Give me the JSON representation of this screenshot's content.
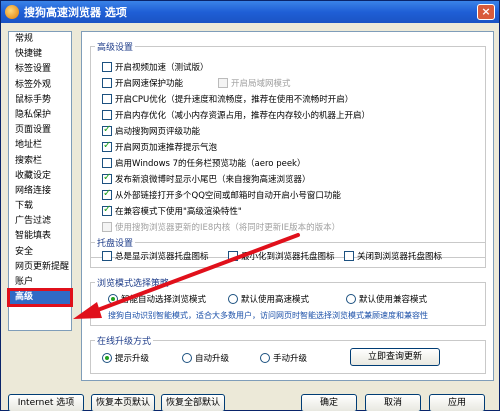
{
  "window": {
    "title": "搜狗高速浏览器 选项",
    "close_label": "×"
  },
  "sidebar": {
    "items": [
      "常规",
      "快捷键",
      "标签设置",
      "标签外观",
      "鼠标手势",
      "隐私保护",
      "页面设置",
      "地址栏",
      "搜索栏",
      "收藏设定",
      "网络连接",
      "下载",
      "广告过滤",
      "智能填表",
      "安全",
      "网页更新提醒",
      "账户",
      "高级"
    ],
    "selected": "高级"
  },
  "advanced": {
    "legend": "高级设置",
    "items": [
      {
        "label": "开启视频加速（测试版）",
        "checked": false,
        "disabled": false
      },
      {
        "label": "开启网速保护功能",
        "checked": false,
        "disabled": false
      },
      {
        "label": "开启局域网模式",
        "checked": false,
        "disabled": true
      },
      {
        "label": "开启CPU优化（提升速度和流畅度，推荐在使用不流畅时开启）",
        "checked": false,
        "disabled": false
      },
      {
        "label": "开启内存优化（减小内存资源占用，推荐在内存较小的机器上开启）",
        "checked": false,
        "disabled": false
      },
      {
        "label": "启动搜狗网页评级功能",
        "checked": true,
        "disabled": false
      },
      {
        "label": "开启网页加速推荐提示气泡",
        "checked": true,
        "disabled": false
      },
      {
        "label": "启用Windows 7的任务栏预览功能（aero peek）",
        "checked": false,
        "disabled": false
      },
      {
        "label": "发布新浪微博时显示小尾巴（来自搜狗高速浏览器）",
        "checked": true,
        "disabled": false
      },
      {
        "label": "从外部链接打开多个QQ空间或邮箱时自动开启小号窗口功能",
        "checked": true,
        "disabled": false
      },
      {
        "label": "在兼容模式下使用\"高级渲染特性\"",
        "checked": true,
        "disabled": false
      },
      {
        "label": "使用搜狗浏览器更新的IE8内核（将同时更新IE版本的版本）",
        "checked": false,
        "disabled": true
      }
    ]
  },
  "tray": {
    "legend": "托盘设置",
    "items": [
      {
        "label": "总是显示浏览器托盘图标",
        "checked": false
      },
      {
        "label": "最小化到浏览器托盘图标",
        "checked": false
      },
      {
        "label": "关闭到浏览器托盘图标",
        "checked": false
      }
    ]
  },
  "browse_mode": {
    "legend": "浏览模式选择策略",
    "options": [
      {
        "label": "智能自动选择浏览模式",
        "checked": true
      },
      {
        "label": "默认使用高速模式",
        "checked": false
      },
      {
        "label": "默认使用兼容模式",
        "checked": false
      }
    ],
    "hint": "搜狗自动识别智能模式，适合大多数用户，访问网页时智能选择浏览模式兼顾速度和兼容性"
  },
  "upgrade": {
    "legend": "在线升级方式",
    "options": [
      {
        "label": "提示升级",
        "checked": true
      },
      {
        "label": "自动升级",
        "checked": false
      },
      {
        "label": "手动升级",
        "checked": false
      }
    ],
    "check_button": "立即查询更新"
  },
  "footer": {
    "internet_options": "Internet 选项",
    "restore_page": "恢复本页默认",
    "restore_all": "恢复全部默认",
    "ok": "确定",
    "cancel": "取消",
    "apply": "应用"
  },
  "colors": {
    "arrow": "#e0101b",
    "title_bar": "#1f5fd6",
    "selected": "#316ac5"
  }
}
